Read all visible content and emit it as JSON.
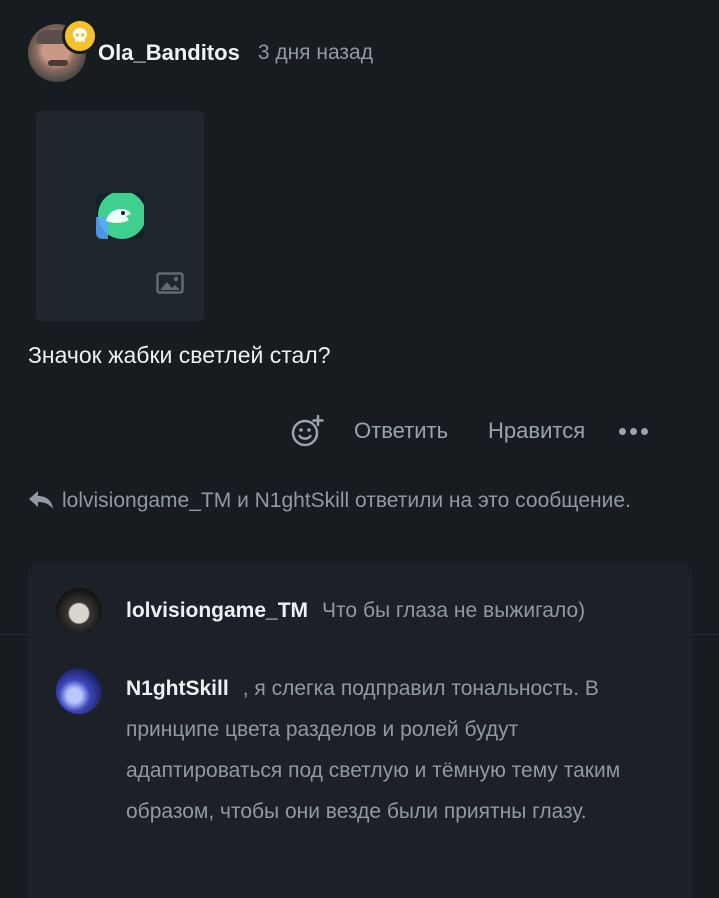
{
  "post": {
    "author": "Ola_Banditos",
    "time": "3 дня назад",
    "message": "Значок жабки светлей стал?",
    "avatar_badge_icon": "skull-icon",
    "badge_color": "#f2c12e"
  },
  "actions": {
    "reply_label": "Ответить",
    "like_label": "Нравится",
    "emoji_icon": "add-reaction-icon",
    "more_icon": "more-horizontal-icon"
  },
  "replies_summary": {
    "icon": "reply-arrow-icon",
    "text": "lolvisiongame_TM и N1ghtSkill ответили на это сообщение."
  },
  "replies": [
    {
      "user": "lolvisiongame_TM",
      "text": "Что бы глаза не выжигало)"
    },
    {
      "user": "N1ghtSkill",
      "text": ", я слегка подправил тональность. В принципе цвета разделов и ролей будут адаптироваться под светлую и тёмную тему таким образом, чтобы они везде были приятны глазу."
    }
  ],
  "colors": {
    "background": "#171c20",
    "muted_text": "#8f9aa1",
    "accent_green": "#3fd08f"
  }
}
